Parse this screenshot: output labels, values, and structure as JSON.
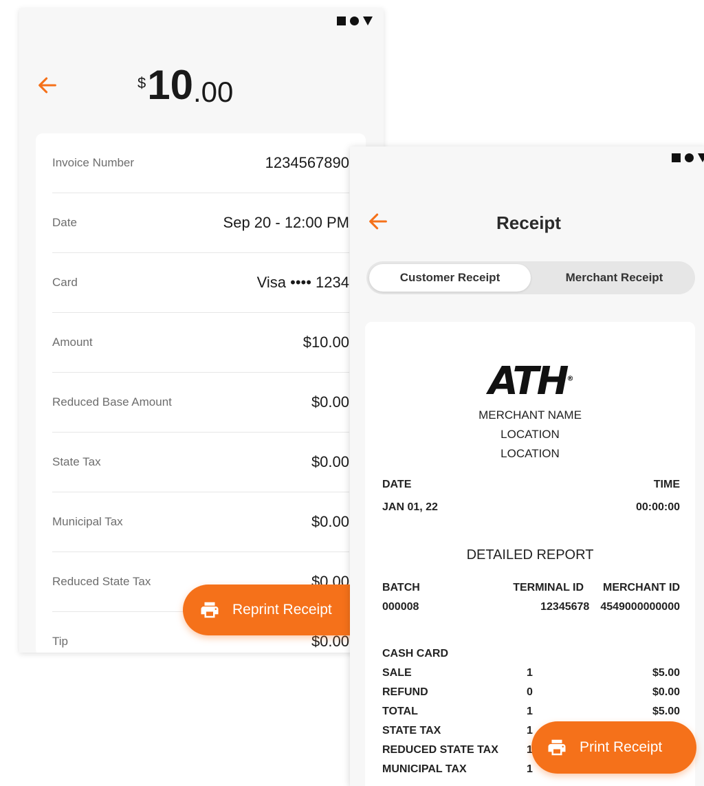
{
  "screen1": {
    "amount": {
      "currency": "$",
      "whole": "10",
      "cents": ".00"
    },
    "details": [
      {
        "label": "Invoice Number",
        "value": "1234567890"
      },
      {
        "label": "Date",
        "value": "Sep 20 - 12:00 PM"
      },
      {
        "label": "Card",
        "value": "Visa •••• 1234"
      },
      {
        "label": "Amount",
        "value": "$10.00"
      },
      {
        "label": "Reduced Base Amount",
        "value": "$0.00"
      },
      {
        "label": "State Tax",
        "value": "$0.00"
      },
      {
        "label": "Municipal Tax",
        "value": "$0.00"
      },
      {
        "label": "Reduced State Tax",
        "value": "$0.00"
      },
      {
        "label": "Tip",
        "value": "$0.00"
      }
    ],
    "reprint_label": "Reprint Receipt"
  },
  "screen2": {
    "title": "Receipt",
    "tabs": [
      {
        "label": "Customer Receipt",
        "active": true
      },
      {
        "label": "Merchant Receipt",
        "active": false
      }
    ],
    "receipt": {
      "logo": "ATH",
      "logo_mark": "®",
      "merchant_name": "MERCHANT NAME",
      "location1": "LOCATION",
      "location2": "LOCATION",
      "date_label": "DATE",
      "time_label": "TIME",
      "date_value": "JAN 01, 22",
      "time_value": "00:00:00",
      "report_title": "DETAILED REPORT",
      "batch_label": "BATCH",
      "terminal_label": "TERMINAL ID",
      "merchant_id_label": "MERCHANT ID",
      "batch_value": "000008",
      "terminal_value": "12345678",
      "merchant_id_value": "4549000000000",
      "section": "CASH CARD",
      "lines": [
        {
          "label": "SALE",
          "count": "1",
          "amount": "$5.00"
        },
        {
          "label": "REFUND",
          "count": "0",
          "amount": "$0.00"
        },
        {
          "label": "TOTAL",
          "count": "1",
          "amount": "$5.00"
        },
        {
          "label": "STATE TAX",
          "count": "1",
          "amount": ""
        },
        {
          "label": "REDUCED STATE TAX",
          "count": "1",
          "amount": ""
        },
        {
          "label": "MUNICIPAL TAX",
          "count": "1",
          "amount": ""
        }
      ]
    },
    "print_label": "Print Receipt"
  },
  "colors": {
    "accent": "#f5711a",
    "background": "#f7f7f7",
    "card": "#ffffff"
  },
  "icons": {
    "back": "arrow-left-icon",
    "printer": "printer-icon"
  }
}
